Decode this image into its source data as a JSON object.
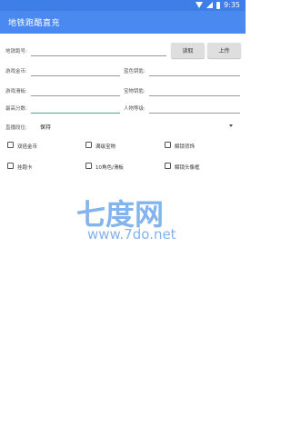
{
  "status_bar": {
    "time": "9:35"
  },
  "app_bar": {
    "title": "地铁跑酷直充"
  },
  "form": {
    "account_label": "地铁跑号:",
    "read_button": "读取",
    "upload_button": "上传",
    "coins_label": "游戏金币:",
    "keys_label": "蓝色钥匙:",
    "skateboards_label": "游戏滑板:",
    "treasure_keys_label": "宝物钥匙:",
    "highscore_label": "最高分数:",
    "level_label": "人物等级:",
    "rank_label": "直播段位:",
    "rank_value": "保持"
  },
  "checkboxes": [
    {
      "label": "双倍金币",
      "checked": false
    },
    {
      "label": "满级宝物",
      "checked": false
    },
    {
      "label": "解锁背饰",
      "checked": false
    },
    {
      "label": "挂跑卡",
      "checked": false
    },
    {
      "label": "10角色/滑板",
      "checked": false
    },
    {
      "label": "解锁头像框",
      "checked": false
    }
  ],
  "watermark": {
    "brand": "七度网",
    "url": "www.7do.net"
  },
  "colors": {
    "status_bar": "#3d7fe6",
    "app_bar": "#4a8af0",
    "focus_underline": "#46a59e",
    "watermark": "#6ea7ea"
  }
}
